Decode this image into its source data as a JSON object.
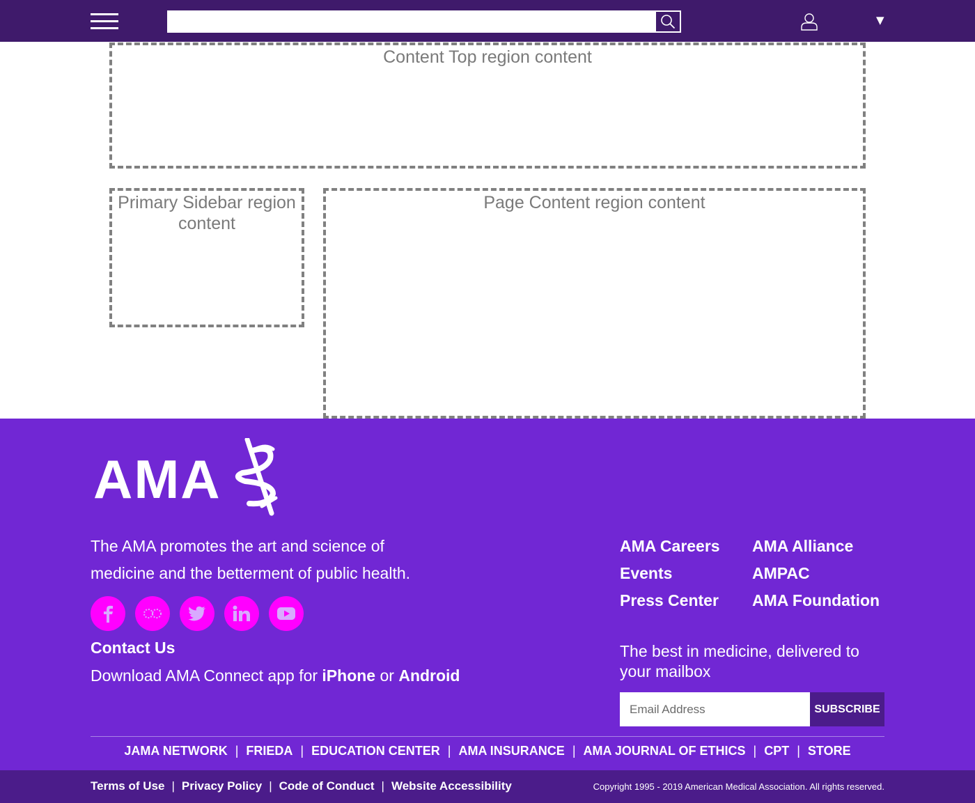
{
  "header": {
    "search": {
      "placeholder": "",
      "value": ""
    },
    "dropdown_glyph": "▼"
  },
  "regions": {
    "content_top": "Content Top region content",
    "primary_sidebar": "Primary Sidebar region content",
    "page_content": "Page Content region content"
  },
  "footer": {
    "logo_text": "AMA",
    "tagline": "The AMA promotes the art and science of medicine and the betterment of public health.",
    "social": [
      "facebook-icon",
      "flickr-icon",
      "twitter-icon",
      "linkedin-icon",
      "youtube-icon"
    ],
    "contact": "Contact Us",
    "download": {
      "prefix": "Download AMA Connect app for ",
      "iphone": "iPhone",
      "or": " or ",
      "android": "Android"
    },
    "links_col1": [
      "AMA Careers",
      "Events",
      "Press Center"
    ],
    "links_col2": [
      "AMA Alliance",
      "AMPAC",
      "AMA Foundation"
    ],
    "newsletter": {
      "text": "The best in medicine, delivered to your mailbox",
      "placeholder": "Email Address",
      "button": "SUBSCRIBE"
    },
    "partners": [
      "JAMA NETWORK",
      "FRIEDA",
      "EDUCATION CENTER",
      "AMA INSURANCE",
      "AMA JOURNAL OF ETHICS",
      "CPT",
      "STORE"
    ],
    "separator": "|",
    "legal": [
      "Terms of Use",
      "Privacy Policy",
      "Code of Conduct",
      "Website Accessibility"
    ],
    "copyright": "Copyright 1995 - 2019 American Medical Association. All rights reserved."
  },
  "colors": {
    "header_bg": "#3f1a6b",
    "footer_bg": "#7127d4",
    "social_bg": "#ff00ff",
    "bottom_bar_bg": "#4b1c8a"
  }
}
